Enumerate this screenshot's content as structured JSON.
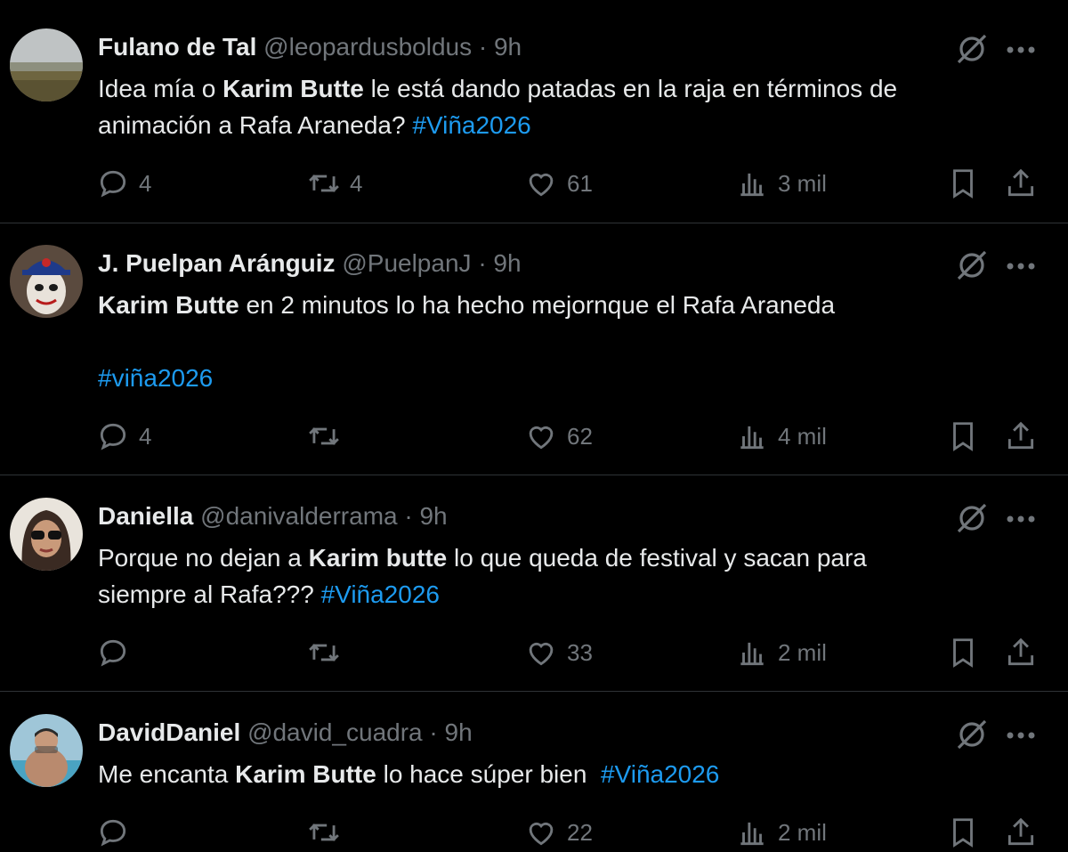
{
  "tweets": [
    {
      "name": "Fulano de Tal",
      "handle": "@leopardusboldus",
      "dot": "·",
      "time": "9h",
      "line1": [
        {
          "t": "Idea mía o ",
          "s": "plain"
        },
        {
          "t": "Karim Butte",
          "s": "bold"
        },
        {
          "t": " le está dando patadas en la raja en términos de",
          "s": "plain"
        }
      ],
      "line2": [
        {
          "t": "animación a Rafa Araneda? ",
          "s": "plain"
        },
        {
          "t": "#Viña2026",
          "s": "hashtag"
        }
      ],
      "replies": "4",
      "retweets": "4",
      "likes": "61",
      "views": "3 mil"
    },
    {
      "name": "J. Puelpan Aránguiz",
      "handle": "@PuelpanJ",
      "dot": "·",
      "time": "9h",
      "line1": [
        {
          "t": "Karim Butte",
          "s": "bold"
        },
        {
          "t": " en 2 minutos lo ha hecho mejornque el Rafa Araneda",
          "s": "plain"
        }
      ],
      "line2": [
        {
          "t": "#viña2026",
          "s": "hashtag"
        }
      ],
      "replies": "4",
      "retweets": "",
      "likes": "62",
      "views": "4 mil"
    },
    {
      "name": "Daniella",
      "handle": "@danivalderrama",
      "dot": "·",
      "time": "9h",
      "line1": [
        {
          "t": "Porque no dejan a ",
          "s": "plain"
        },
        {
          "t": "Karim butte",
          "s": "bold"
        },
        {
          "t": " lo que queda de festival y sacan para",
          "s": "plain"
        }
      ],
      "line2": [
        {
          "t": "siempre al Rafa??? ",
          "s": "plain"
        },
        {
          "t": "#Viña2026",
          "s": "hashtag"
        }
      ],
      "replies": "",
      "retweets": "",
      "likes": "33",
      "views": "2 mil"
    },
    {
      "name": "DavidDaniel",
      "handle": "@david_cuadra",
      "dot": "·",
      "time": "9h",
      "line1": [
        {
          "t": "Me encanta ",
          "s": "plain"
        },
        {
          "t": "Karim Butte",
          "s": "bold"
        },
        {
          "t": " lo hace súper bien  ",
          "s": "plain"
        },
        {
          "t": "#Viña2026",
          "s": "hashtag"
        }
      ],
      "line2": [],
      "replies": "",
      "retweets": "",
      "likes": "22",
      "views": "2 mil"
    }
  ],
  "colors": {
    "background": "#000000",
    "text": "#e7e9ea",
    "secondary": "#71767b",
    "hashtag": "#1d9bf0",
    "separator": "#2f3336"
  },
  "icons": [
    "reply-icon",
    "retweet-icon",
    "like-icon",
    "views-icon",
    "bookmark-icon",
    "share-icon",
    "grok-icon",
    "more-icon"
  ]
}
